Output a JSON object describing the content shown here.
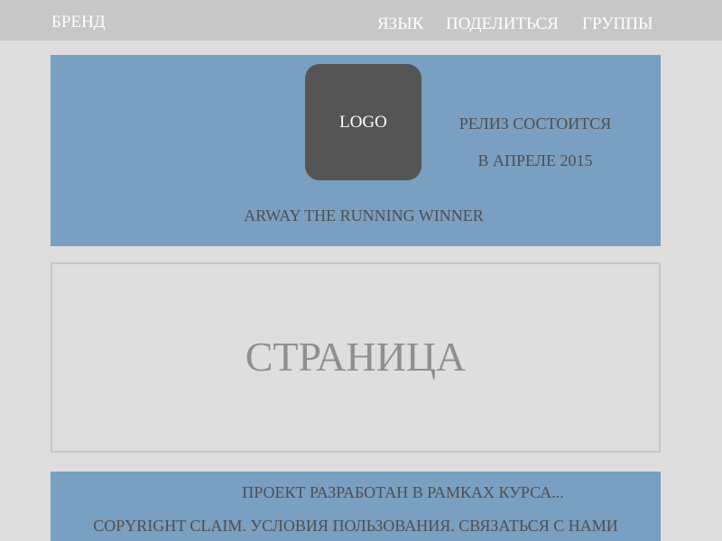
{
  "header": {
    "brand": "БРЕНД",
    "nav": {
      "language": "ЯЗЫК",
      "share": "ПОДЕЛИТЬСЯ",
      "groups": "ГРУППЫ"
    }
  },
  "hero": {
    "logo_text": "LOGO",
    "release_line1": "РЕЛИЗ СОСТОИТСЯ",
    "release_line2": "В АПРЕЛЕ 2015",
    "tagline": "ARWAY THE RUNNING WINNER"
  },
  "main": {
    "title": "СТРАНИЦА"
  },
  "footer": {
    "project_note": "ПРОЕКТ РАЗРАБОТАН В РАМКАХ КУРСА...",
    "copyright": "COPYRIGHT CLAIM.",
    "terms": "УСЛОВИЯ ПОЛЬЗОВАНИЯ.",
    "contact": "СВЯЗАТЬСЯ С НАМИ"
  },
  "colors": {
    "page_background": "#dedede",
    "topbar": "#c7c7c7",
    "accent_blue": "#799fc1",
    "logo_box": "#555555",
    "text_dark": "#4f4f4f",
    "text_muted": "#8f8f8f"
  }
}
